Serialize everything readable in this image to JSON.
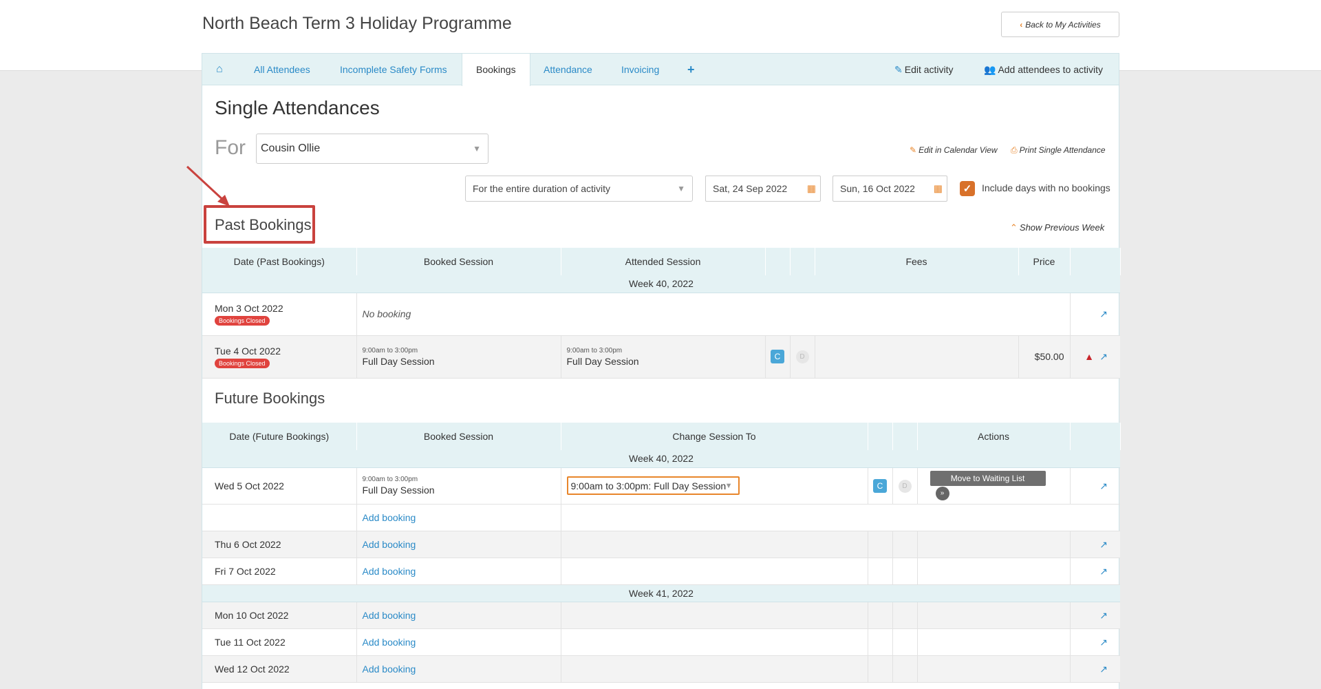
{
  "header": {
    "title": "North Beach Term 3 Holiday Programme",
    "back_label": "Back to My Activities"
  },
  "tabs": [
    {
      "label": "All Attendees"
    },
    {
      "label": "Incomplete Safety Forms"
    },
    {
      "label": "Bookings"
    },
    {
      "label": "Attendance"
    },
    {
      "label": "Invoicing"
    }
  ],
  "tab_actions": {
    "edit": "Edit activity",
    "add": "Add attendees to activity"
  },
  "page": {
    "title": "Single Attendances",
    "for_label": "For",
    "attendee": "Cousin Ollie",
    "edit_calendar": "Edit in Calendar View",
    "print": "Print Single Attendance",
    "duration": "For the entire duration of activity",
    "start_date": "Sat, 24 Sep 2022",
    "end_date": "Sun, 16 Oct 2022",
    "include_label": "Include days with no bookings",
    "show_prev": "Show Previous Week"
  },
  "past": {
    "title": "Past Bookings",
    "headers": [
      "Date (Past Bookings)",
      "Booked Session",
      "Attended Session",
      "",
      "",
      "Fees",
      "Price",
      ""
    ],
    "week": "Week 40, 2022",
    "rows": [
      {
        "date": "Mon 3 Oct 2022",
        "badge": "Bookings Closed",
        "booked": "No booking"
      },
      {
        "date": "Tue 4 Oct 2022",
        "badge": "Bookings Closed",
        "time": "9:00am to 3:00pm",
        "booked": "Full Day Session",
        "attended_time": "9:00am to 3:00pm",
        "attended": "Full Day Session",
        "c": "C",
        "d": "D",
        "price": "$50.00"
      }
    ]
  },
  "future": {
    "title": "Future Bookings",
    "headers": [
      "Date (Future Bookings)",
      "Booked Session",
      "Change Session To",
      "",
      "",
      "Actions",
      ""
    ],
    "week40": "Week 40, 2022",
    "week41": "Week 41, 2022",
    "booking": {
      "date": "Wed 5 Oct 2022",
      "time": "9:00am to 3:00pm",
      "session": "Full Day Session",
      "change_to": "9:00am to 3:00pm: Full Day Session",
      "c": "C",
      "d": "D",
      "action": "Move to Waiting List"
    },
    "add_label": "Add booking",
    "rows": [
      {
        "date": "Thu 6 Oct 2022"
      },
      {
        "date": "Fri 7 Oct 2022"
      }
    ],
    "rows41": [
      {
        "date": "Mon 10 Oct 2022"
      },
      {
        "date": "Tue 11 Oct 2022"
      },
      {
        "date": "Wed 12 Oct 2022"
      }
    ]
  }
}
